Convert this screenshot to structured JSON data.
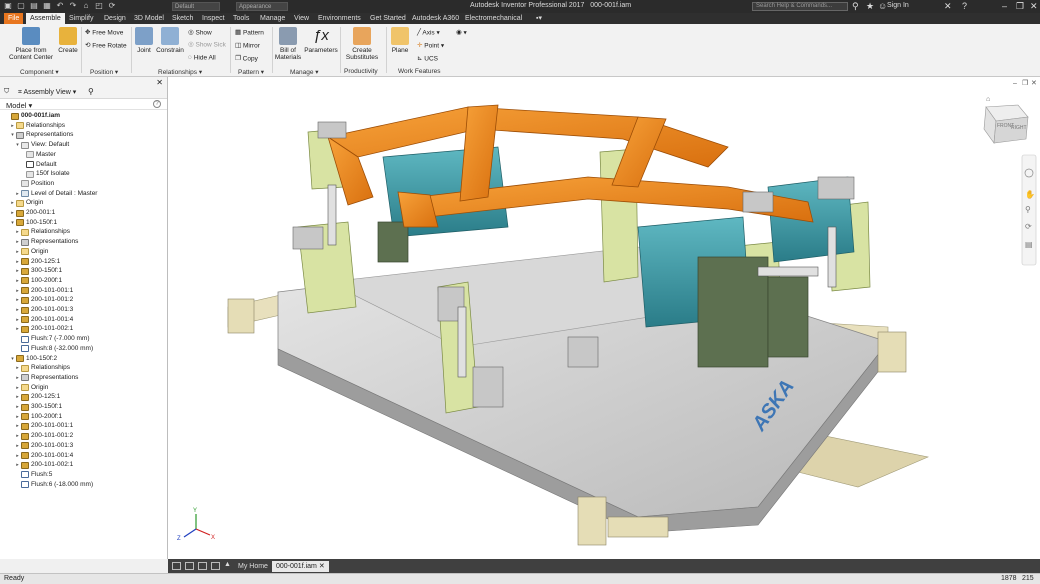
{
  "app": {
    "title": "Autodesk Inventor Professional 2017",
    "document": "000-001f.iam",
    "search_placeholder": "Search Help & Commands...",
    "sign_in": "Sign In",
    "project_label": "Default",
    "appearance_label": "Appearance"
  },
  "tabs": [
    "File",
    "Assemble",
    "Simplify",
    "Design",
    "3D Model",
    "Sketch",
    "Inspect",
    "Tools",
    "Manage",
    "View",
    "Environments",
    "Get Started",
    "Autodesk A360",
    "Electromechanical"
  ],
  "ribbon": {
    "place_from_cc": [
      "Place from",
      "Content Center"
    ],
    "create": "Create",
    "free_move": "Free Move",
    "free_rotate": "Free Rotate",
    "joint": "Joint",
    "constrain": "Constrain",
    "show": "Show",
    "show_sick": "Show Sick",
    "hide_all": "Hide All",
    "pattern": "Pattern",
    "mirror": "Mirror",
    "copy": "Copy",
    "bill_of_materials": [
      "Bill of",
      "Materials"
    ],
    "parameters": "Parameters",
    "create_substitutes": [
      "Create",
      "Substitutes"
    ],
    "plane": "Plane",
    "axis": "Axis",
    "point": "Point",
    "ucs": "UCS",
    "panels": {
      "component": "Component",
      "position": "Position",
      "relationships": "Relationships",
      "pattern": "Pattern",
      "manage": "Manage",
      "productivity": "Productivity",
      "work_features": "Work Features"
    }
  },
  "browser": {
    "view_label": "Assembly View",
    "model_label": "Model",
    "help_label": "?",
    "tree": [
      {
        "label": "000-001f.iam",
        "icon": "asm",
        "level": 0,
        "tw": "",
        "bold": true
      },
      {
        "label": "Relationships",
        "icon": "fold",
        "level": 1,
        "tw": "▸"
      },
      {
        "label": "Representations",
        "icon": "rep",
        "level": 1,
        "tw": "▾"
      },
      {
        "label": "View: Default",
        "icon": "view",
        "level": 2,
        "tw": "▾"
      },
      {
        "label": "Master",
        "icon": "pos",
        "level": 3,
        "tw": ""
      },
      {
        "label": "Default",
        "icon": "chk",
        "level": 3,
        "tw": ""
      },
      {
        "label": "150f Isolate",
        "icon": "pos",
        "level": 3,
        "tw": ""
      },
      {
        "label": "Position",
        "icon": "pos",
        "level": 2,
        "tw": ""
      },
      {
        "label": "Level of Detail : Master",
        "icon": "lod",
        "level": 2,
        "tw": "▸"
      },
      {
        "label": "Origin",
        "icon": "fold",
        "level": 1,
        "tw": "▸"
      },
      {
        "label": "200-001:1",
        "icon": "asm",
        "level": 1,
        "tw": "▸"
      },
      {
        "label": "100-150f:1",
        "icon": "asm",
        "level": 1,
        "tw": "▾"
      },
      {
        "label": "Relationships",
        "icon": "fold",
        "level": 2,
        "tw": "▸"
      },
      {
        "label": "Representations",
        "icon": "rep",
        "level": 2,
        "tw": "▸"
      },
      {
        "label": "Origin",
        "icon": "fold",
        "level": 2,
        "tw": "▸"
      },
      {
        "label": "200-125:1",
        "icon": "asm",
        "level": 2,
        "tw": "▸"
      },
      {
        "label": "300-150f:1",
        "icon": "asm",
        "level": 2,
        "tw": "▸"
      },
      {
        "label": "100-200f:1",
        "icon": "asm",
        "level": 2,
        "tw": "▸"
      },
      {
        "label": "200-101-001:1",
        "icon": "asm",
        "level": 2,
        "tw": "▸"
      },
      {
        "label": "200-101-001:2",
        "icon": "asm",
        "level": 2,
        "tw": "▸"
      },
      {
        "label": "200-101-001:3",
        "icon": "asm",
        "level": 2,
        "tw": "▸"
      },
      {
        "label": "200-101-001:4",
        "icon": "asm",
        "level": 2,
        "tw": "▸"
      },
      {
        "label": "200-101-002:1",
        "icon": "asm",
        "level": 2,
        "tw": "▸"
      },
      {
        "label": "Flush:7 (-7.000 mm)",
        "icon": "flush",
        "level": 2,
        "tw": ""
      },
      {
        "label": "Flush:8 (-32.000 mm)",
        "icon": "flush",
        "level": 2,
        "tw": ""
      },
      {
        "label": "100-150f:2",
        "icon": "asm",
        "level": 1,
        "tw": "▾"
      },
      {
        "label": "Relationships",
        "icon": "fold",
        "level": 2,
        "tw": "▸"
      },
      {
        "label": "Representations",
        "icon": "rep",
        "level": 2,
        "tw": "▸"
      },
      {
        "label": "Origin",
        "icon": "fold",
        "level": 2,
        "tw": "▸"
      },
      {
        "label": "200-125:1",
        "icon": "asm",
        "level": 2,
        "tw": "▸"
      },
      {
        "label": "300-150f:1",
        "icon": "asm",
        "level": 2,
        "tw": "▸"
      },
      {
        "label": "100-200f:1",
        "icon": "asm",
        "level": 2,
        "tw": "▸"
      },
      {
        "label": "200-101-001:1",
        "icon": "asm",
        "level": 2,
        "tw": "▸"
      },
      {
        "label": "200-101-001:2",
        "icon": "asm",
        "level": 2,
        "tw": "▸"
      },
      {
        "label": "200-101-001:3",
        "icon": "asm",
        "level": 2,
        "tw": "▸"
      },
      {
        "label": "200-101-001:4",
        "icon": "asm",
        "level": 2,
        "tw": "▸"
      },
      {
        "label": "200-101-002:1",
        "icon": "asm",
        "level": 2,
        "tw": "▸"
      },
      {
        "label": "Flush:5",
        "icon": "flush",
        "level": 2,
        "tw": ""
      },
      {
        "label": "Flush:6 (-18.000 mm)",
        "icon": "flush",
        "level": 2,
        "tw": ""
      }
    ]
  },
  "viewcube": {
    "face_front": "FRONT",
    "face_right": "RIGHT"
  },
  "triad": {
    "x": "X",
    "y": "Y",
    "z": "Z"
  },
  "model_brand": "ASKA",
  "doctabs": {
    "home": "My Home",
    "doc": "000-001f.iam"
  },
  "status": {
    "text": "Ready",
    "count1": "1878",
    "count2": "215"
  },
  "colors": {
    "file_tab": "#e8761f",
    "frame_orange": "#f08a1c",
    "teal": "#3d9ca8",
    "green_clamp": "#d7e2a0",
    "base_plate": "#c9c9c9",
    "dark_green": "#5b6e4f",
    "titlebar": "#2b2b2b"
  }
}
